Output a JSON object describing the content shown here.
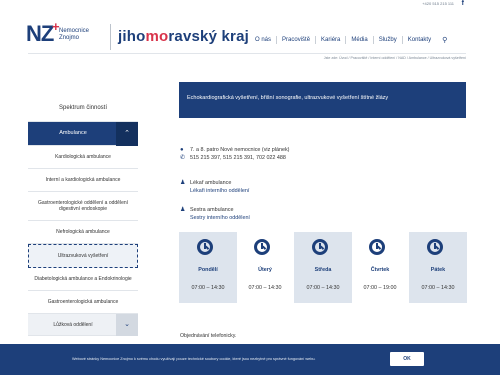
{
  "top": {
    "phone": "+420 515 215 111",
    "facebook_icon": "facebook-icon"
  },
  "logo": {
    "mark": "NZ",
    "plus": "+",
    "line1": "Nemocnice",
    "line2": "Znojmo"
  },
  "brand": {
    "part1": "jiho",
    "part2": "mo",
    "part3": "ravský kraj"
  },
  "nav": {
    "items": [
      "O nás",
      "Pracoviště",
      "Kariéra",
      "Média",
      "Služby",
      "Kontakty"
    ],
    "search_icon": "search-icon"
  },
  "breadcrumb": "Jste zde:  Úvod  /  Pracoviště  /  Interní oddělení  /  NAD  /  Ambulance  /  Ultrazvuková vyšetření",
  "sidebar": {
    "title": "Spektrum činností",
    "active": "Ambulance",
    "items": [
      "Kardiologická ambulance",
      "Interní a kardiologická ambulance",
      "Gastroenterologické oddělení a oddělení digestivní endoskopie",
      "Nefrologická ambulance",
      "Ultrazvuková vyšetření",
      "Diabetologická ambulance a Endokrinologie",
      "Gastroenterologická ambulance"
    ],
    "bottom": "Lůžková oddělení"
  },
  "banner": "Echokardiografická vyšetření, břišní sonografie, ultrazvukové vyšetření štítné žlázy",
  "info": {
    "location": "7. a 8. patro Nové nemocnice (viz plánek)",
    "phones": "515 215 397, 515 215 391, 702 022 488"
  },
  "doctor": {
    "label": "Lékař ambulance",
    "link": "Lékaři interního oddělení"
  },
  "nurse": {
    "label": "Sestra ambulance",
    "link": "Sestry interního oddělení"
  },
  "days": [
    {
      "name": "Pondělí",
      "hours": "07:00 – 14:30",
      "shaded": true
    },
    {
      "name": "Úterý",
      "hours": "07:00 – 14:30",
      "shaded": false
    },
    {
      "name": "Středa",
      "hours": "07:00 – 14:30",
      "shaded": true
    },
    {
      "name": "Čtvrtek",
      "hours": "07:00 – 19:00",
      "shaded": false
    },
    {
      "name": "Pátek",
      "hours": "07:00 – 14:30",
      "shaded": true
    }
  ],
  "footnote": "Objednávání telefonicky.",
  "cookie": {
    "message": "Webové stránky Nemocnice Znojmo k svému chodu využívají pouze technické soubory cookie, které jsou nezbytné pro správné fungování webu.",
    "ok": "OK"
  },
  "colors": {
    "primary": "#1d3f7a",
    "accent": "#d8334a",
    "shade": "#dde4ed"
  }
}
